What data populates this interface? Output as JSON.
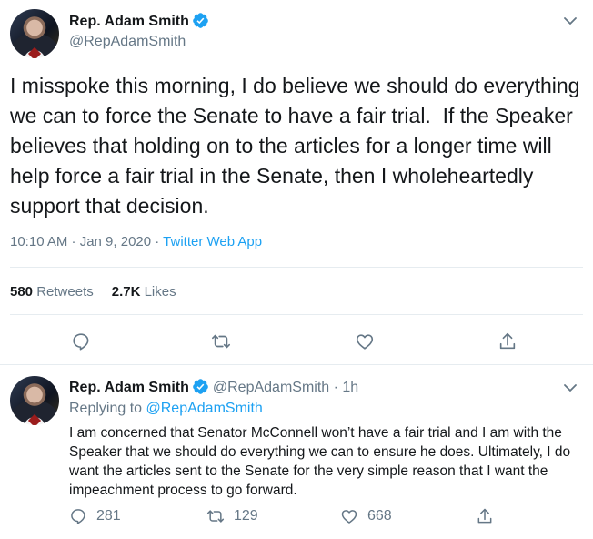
{
  "main_tweet": {
    "name": "Rep. Adam Smith",
    "handle": "@RepAdamSmith",
    "text": "I misspoke this morning, I do believe we should do everything we can to force the Senate to have a fair trial.  If the Speaker believes that holding on to the articles for a longer time will help force a fair trial in the Senate, then I wholeheartedly support that decision.",
    "timestamp": "10:10 AM · Jan 9, 2020 · ",
    "source_app": "Twitter Web App",
    "retweets_count": "580",
    "retweets_label": "Retweets",
    "likes_count": "2.7K",
    "likes_label": "Likes"
  },
  "reply_tweet": {
    "name": "Rep. Adam Smith",
    "handle_time": "@RepAdamSmith · 1h",
    "replying_prefix": "Replying to ",
    "replying_to": "@RepAdamSmith",
    "text": "I am concerned that Senator McConnell won’t have a fair trial and I am with the Speaker that we should do everything we can to ensure he does. Ultimately, I do want the articles sent to the Senate for the very simple reason that I want the impeachment process to go forward.",
    "reply_count": "281",
    "retweet_count": "129",
    "like_count": "668"
  },
  "icons": [
    "verified-badge-icon",
    "chevron-down-icon",
    "reply-icon",
    "retweet-icon",
    "like-icon",
    "share-icon"
  ],
  "colors": {
    "accent": "#1da1f2",
    "secondary_text": "#657786",
    "primary_text": "#14171a",
    "divider": "#e6ecf0"
  }
}
